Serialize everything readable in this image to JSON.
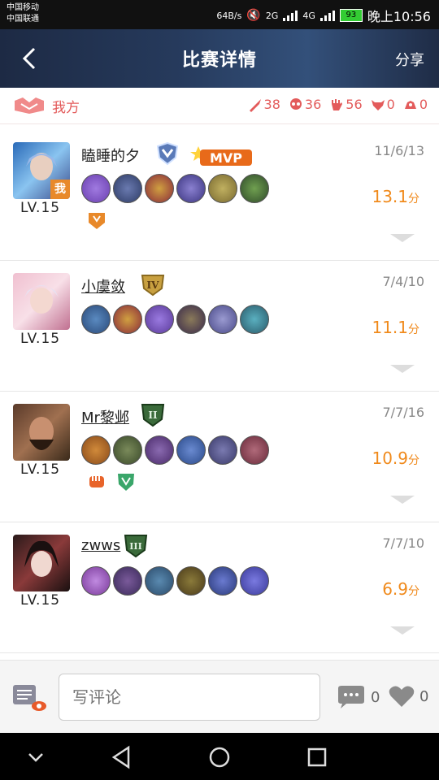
{
  "status_bar": {
    "carrier_1": "中国移动",
    "carrier_2": "中国联通",
    "speed": "64B/s",
    "net_1": "2G",
    "net_2": "4G",
    "battery": "93",
    "time": "晚上10:56"
  },
  "header": {
    "title": "比赛详情",
    "share_label": "分享"
  },
  "team": {
    "label": "我方",
    "stats": [
      {
        "icon": "sword-icon",
        "value": "38"
      },
      {
        "icon": "skull-icon",
        "value": "36"
      },
      {
        "icon": "hand-icon",
        "value": "56"
      },
      {
        "icon": "bull-icon",
        "value": "0"
      },
      {
        "icon": "dragon-icon",
        "value": "0"
      }
    ]
  },
  "players": [
    {
      "name": "瞌睡的夕",
      "level": "LV.15",
      "kda": "11/6/13",
      "score": "13.1",
      "score_unit": "分",
      "is_me": "我",
      "rank": "diamond",
      "mvp": "MVP",
      "items": [
        "#6a3fb0",
        "#2e3c66",
        "#8a2a3a",
        "#3b3580",
        "#7a6a30",
        "#2f4a2a"
      ],
      "extras": [
        "#e8892a"
      ]
    },
    {
      "name": "小虞敛",
      "level": "LV.15",
      "kda": "7/4/10",
      "score": "11.1",
      "score_unit": "分",
      "rank": "IV",
      "items": [
        "#2a4a7a",
        "#8a2a3a",
        "#5a3a9a",
        "#3a2a4a",
        "#4a4a8a",
        "#2a5a6a"
      ],
      "extras": []
    },
    {
      "name": "Mr黎邺",
      "level": "LV.15",
      "kda": "7/7/16",
      "score": "10.9",
      "score_unit": "分",
      "rank": "II",
      "items": [
        "#8a4a1a",
        "#3a4a2a",
        "#4a2a6a",
        "#2a4a8a",
        "#3a3a6a",
        "#6a2a3a"
      ],
      "extras": [
        "#e8642a",
        "#3aa66a"
      ]
    },
    {
      "name": "zwws",
      "level": "LV.15",
      "kda": "7/7/10",
      "score": "6.9",
      "score_unit": "分",
      "rank": "III",
      "items": [
        "#7a3a9a",
        "#3a2a5a",
        "#2a4a6a",
        "#4a3a1a",
        "#2a3a7a",
        "#3a3a9a"
      ],
      "extras": []
    }
  ],
  "bottom": {
    "comment_placeholder": "写评论",
    "comment_count": "0",
    "like_count": "0"
  }
}
